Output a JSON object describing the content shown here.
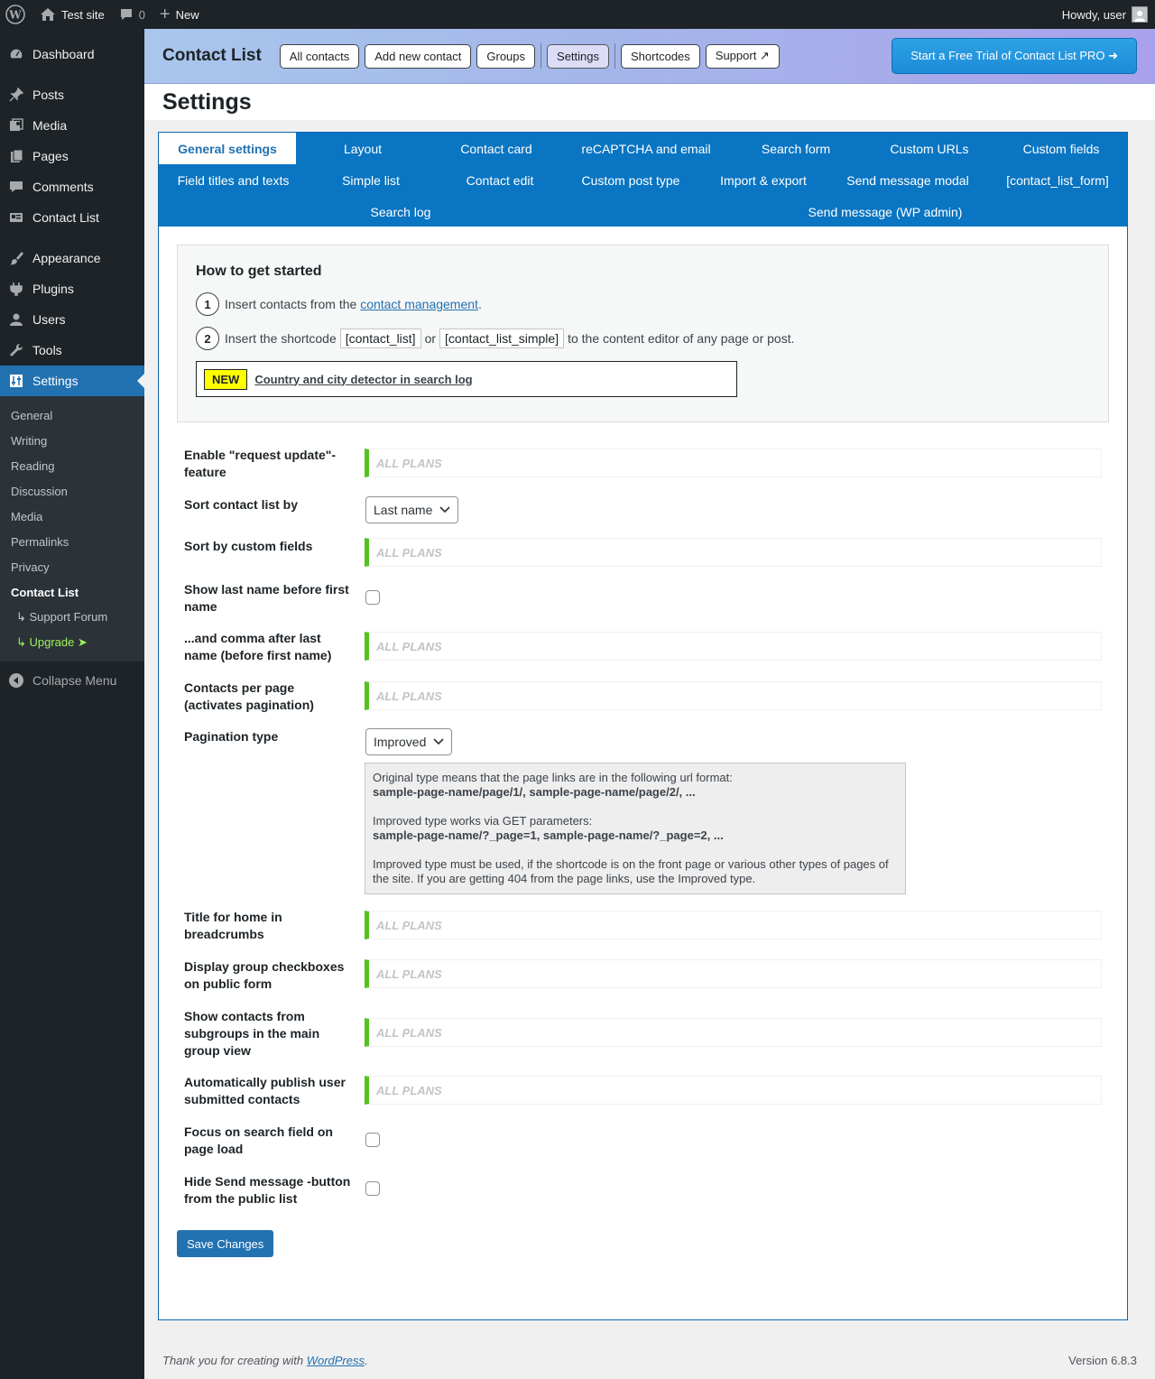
{
  "adminbar": {
    "site_name": "Test site",
    "comments_count": "0",
    "new_label": "New",
    "howdy": "Howdy, user"
  },
  "sidebar": {
    "items": [
      {
        "label": "Dashboard",
        "icon": "dashboard-icon"
      },
      {
        "label": "Posts",
        "icon": "pushpin-icon"
      },
      {
        "label": "Media",
        "icon": "media-icon"
      },
      {
        "label": "Pages",
        "icon": "pages-icon"
      },
      {
        "label": "Comments",
        "icon": "comments-icon"
      },
      {
        "label": "Contact List",
        "icon": "contact-card-icon"
      },
      {
        "label": "Appearance",
        "icon": "brush-icon"
      },
      {
        "label": "Plugins",
        "icon": "plugin-icon"
      },
      {
        "label": "Users",
        "icon": "user-icon"
      },
      {
        "label": "Tools",
        "icon": "wrench-icon"
      },
      {
        "label": "Settings",
        "icon": "settings-sliders-icon"
      }
    ],
    "submenu": [
      "General",
      "Writing",
      "Reading",
      "Discussion",
      "Media",
      "Permalinks",
      "Privacy",
      "Contact List",
      "↳ Support Forum",
      "↳ Upgrade ➤"
    ],
    "collapse": "Collapse Menu"
  },
  "header": {
    "title": "Contact List",
    "buttons": [
      "All contacts",
      "Add new contact",
      "Groups",
      "Settings",
      "Shortcodes",
      "Support ↗"
    ],
    "pro_button": "Start a Free Trial of Contact List PRO ➜"
  },
  "page_title": "Settings",
  "tabs": [
    "General settings",
    "Layout",
    "Contact card",
    "reCAPTCHA and email",
    "Search form",
    "Custom URLs",
    "Custom fields",
    "Field titles and texts",
    "Simple list",
    "Contact edit",
    "Custom post type",
    "Import & export",
    "Send message modal",
    "[contact_list_form]",
    "Search log",
    "Send message (WP admin)"
  ],
  "getstarted": {
    "title": "How to get started",
    "step1_num": "1",
    "step1_text": "Insert contacts from the",
    "step1_link": "contact management",
    "step1_end": ".",
    "step2_num": "2",
    "step2_text": "Insert the shortcode",
    "step2_code1": "[contact_list]",
    "step2_or": "or",
    "step2_code2": "[contact_list_simple]",
    "step2_end": "to the content editor of any page or post.",
    "new_badge": "NEW",
    "new_link": "Country and city detector in search log"
  },
  "form": {
    "all_plans": "ALL PLANS",
    "rows": [
      "Enable \"request update\"-feature",
      "Sort contact list by",
      "Sort by custom fields",
      "Show last name before first name",
      "...and comma after last name (before first name)",
      "Contacts per page (activates pagination)",
      "Pagination type",
      "Title for home in breadcrumbs",
      "Display group checkboxes on public form",
      "Show contacts from subgroups in the main group view",
      "Automatically publish user submitted contacts",
      "Focus on search field on page load",
      "Hide Send message -button from the public list"
    ],
    "sort_value": "Last name",
    "pagination_value": "Improved",
    "info": {
      "p1": "Original type means that the page links are in the following url format:",
      "p1b": "sample-page-name/page/1/, sample-page-name/page/2/, ...",
      "p2": "Improved type works via GET parameters:",
      "p2b": "sample-page-name/?_page=1, sample-page-name/?_page=2, ...",
      "p3": "Improved type must be used, if the shortcode is on the front page or various other types of pages of the site. If you are getting 404 from the page links, use the Improved type."
    },
    "save": "Save Changes"
  },
  "footer": {
    "thanks": "Thank you for creating with",
    "link": "WordPress",
    "dot": ".",
    "version": "Version 6.8.3"
  }
}
